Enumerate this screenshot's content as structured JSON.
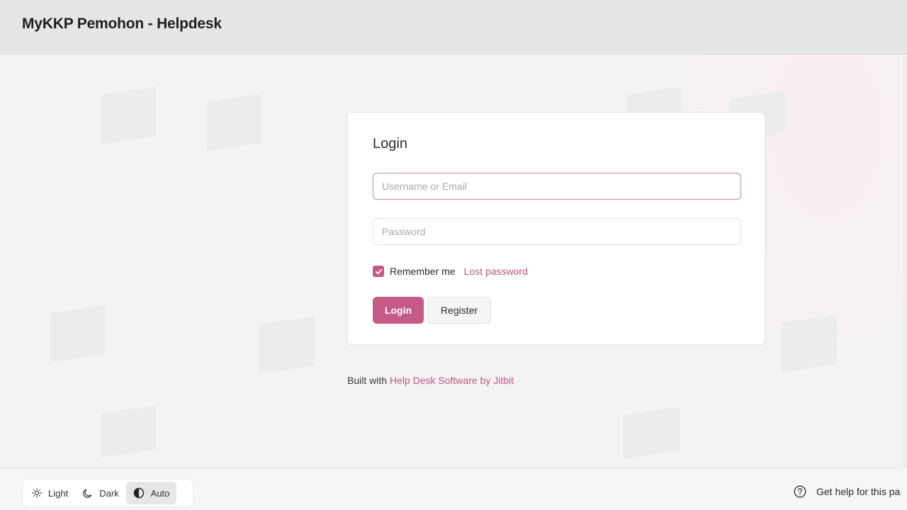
{
  "header": {
    "title": "MyKKP Pemohon - Helpdesk"
  },
  "login": {
    "title": "Login",
    "username_placeholder": "Username or Email",
    "username_value": "",
    "password_placeholder": "Password",
    "password_value": "",
    "remember_label": "Remember me",
    "remember_checked": true,
    "lost_password_label": "Lost password",
    "login_button": "Login",
    "register_button": "Register"
  },
  "built_with": {
    "prefix": "Built with ",
    "link_text": "Help Desk Software by Jitbit"
  },
  "footer": {
    "theme_options": [
      {
        "label": "Light",
        "icon": "sun-icon"
      },
      {
        "label": "Dark",
        "icon": "moon-icon"
      },
      {
        "label": "Auto",
        "icon": "half-circle-icon"
      }
    ],
    "active_theme": "Auto",
    "help_label": "Get help for this pa"
  },
  "colors": {
    "accent": "#c55a86",
    "link": "#c0567f",
    "header_bg": "#e6e5e7",
    "page_bg": "#f4f3f4"
  }
}
